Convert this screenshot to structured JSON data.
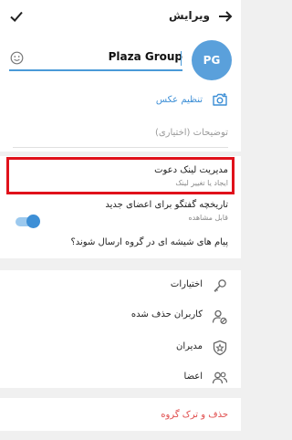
{
  "header": {
    "title": "ویرایش",
    "check_icon": "check-icon",
    "back_icon": "arrow-right-icon"
  },
  "group": {
    "avatar_initials": "PG",
    "name": "Plaza Group",
    "set_photo_label": "تنظیم عکس",
    "description_placeholder": "توضیحات (اختیاری)"
  },
  "settings": {
    "invite_links_title": "مدیریت لینک دعوت",
    "invite_links_subtitle": "ایجاد یا تغییر لینک",
    "history_title": "تاریخچه گفتگو برای اعضای جدید",
    "history_subtitle": "قابل مشاهده",
    "glass_messages_title": "پیام های شیشه ای در گروه ارسال شوند؟",
    "glass_messages_enabled": true
  },
  "management": {
    "items": [
      {
        "label": "اختیارات",
        "icon": "key-icon"
      },
      {
        "label": "کاربران حذف شده",
        "icon": "user-blocked-icon"
      },
      {
        "label": "مدیران",
        "icon": "shield-star-icon"
      },
      {
        "label": "اعضا",
        "icon": "users-icon"
      }
    ]
  },
  "danger": {
    "delete_leave_label": "حذف و ترک گروه"
  },
  "colors": {
    "accent": "#3d8fd6",
    "avatar": "#5aa0db",
    "highlight": "#e0111b",
    "danger": "#e04d4d"
  }
}
